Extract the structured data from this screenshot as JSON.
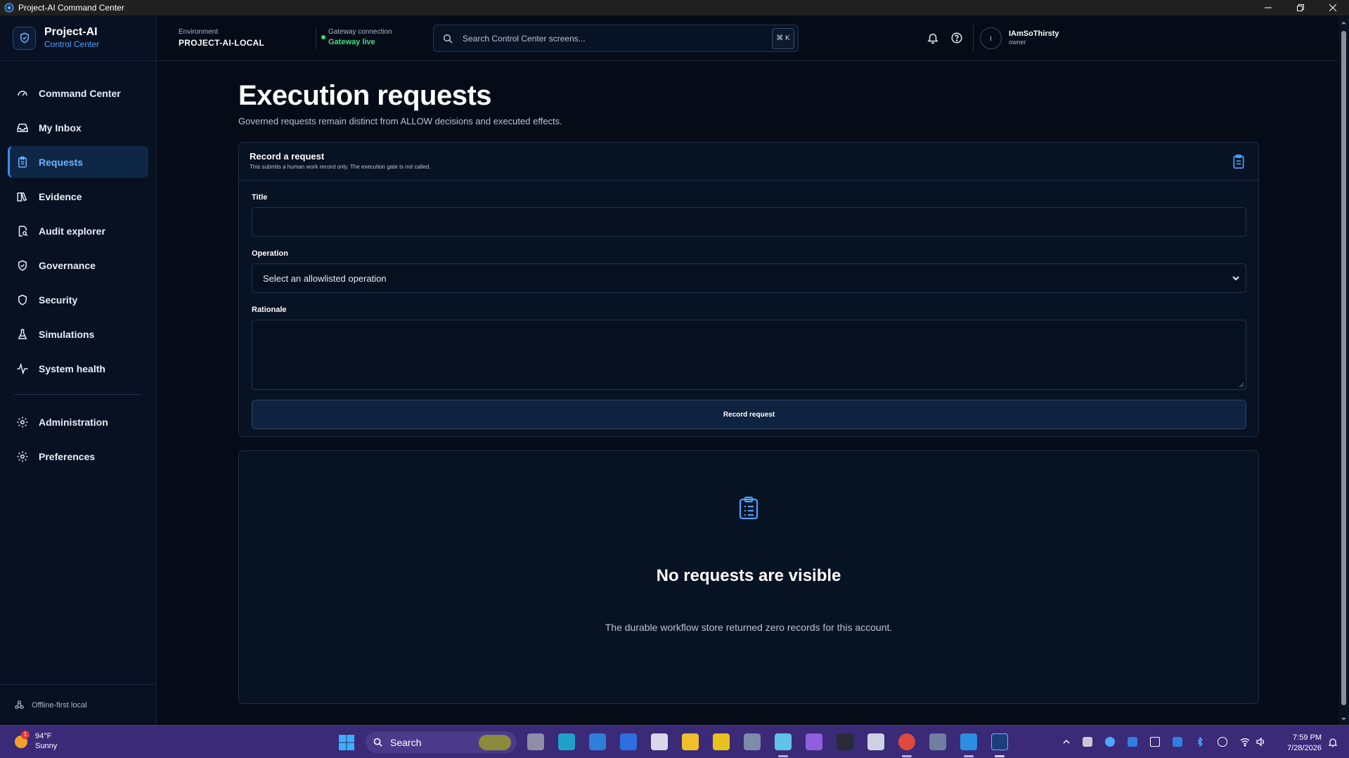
{
  "window": {
    "title": "Project-AI Command Center"
  },
  "brand": {
    "name": "Project-AI",
    "subtitle": "Control Center"
  },
  "sidebar": {
    "items": [
      {
        "label": "Command Center",
        "icon": "gauge-icon",
        "active": false
      },
      {
        "label": "My Inbox",
        "icon": "inbox-icon",
        "active": false
      },
      {
        "label": "Requests",
        "icon": "clipboard-list-icon",
        "active": true
      },
      {
        "label": "Evidence",
        "icon": "book-open-icon",
        "active": false
      },
      {
        "label": "Audit explorer",
        "icon": "audit-search-icon",
        "active": false
      },
      {
        "label": "Governance",
        "icon": "shield-check-icon",
        "active": false
      },
      {
        "label": "Security",
        "icon": "shield-icon",
        "active": false
      },
      {
        "label": "Simulations",
        "icon": "flask-icon",
        "active": false
      },
      {
        "label": "System health",
        "icon": "activity-icon",
        "active": false
      }
    ],
    "secondary": [
      {
        "label": "Administration",
        "icon": "gear-icon"
      },
      {
        "label": "Preferences",
        "icon": "gear-icon"
      }
    ],
    "footer": {
      "label": "Offline-first local",
      "icon": "network-icon"
    }
  },
  "header": {
    "environment_label": "Environment",
    "environment_value": "PROJECT-AI-LOCAL",
    "gateway_label": "Gateway connection",
    "gateway_value": "Gateway live",
    "search_placeholder": "Search Control Center screens...",
    "search_shortcut": "⌘ K",
    "user_initial": "I",
    "user_name": "IAmSoThirsty",
    "user_role": "owner"
  },
  "page": {
    "title": "Execution requests",
    "subtitle": "Governed requests remain distinct from ALLOW decisions and executed effects."
  },
  "form": {
    "title": "Record a request",
    "description": "This submits a human work record only. The execution gate is not called.",
    "title_label": "Title",
    "title_value": "",
    "operation_label": "Operation",
    "operation_selected": "Select an allowlisted operation",
    "rationale_label": "Rationale",
    "rationale_value": "",
    "submit_label": "Record request"
  },
  "empty_state": {
    "title": "No requests are visible",
    "description": "The durable workflow store returned zero records for this account."
  },
  "taskbar": {
    "weather_temp": "94°F",
    "weather_cond": "Sunny",
    "weather_badge": "1",
    "search_label": "Search",
    "time": "7:59 PM",
    "date": "7/28/2026"
  },
  "colors": {
    "accent": "#3b8cff",
    "live": "#3ee081",
    "background": "#050c18",
    "taskbar": "#3a2a78"
  }
}
